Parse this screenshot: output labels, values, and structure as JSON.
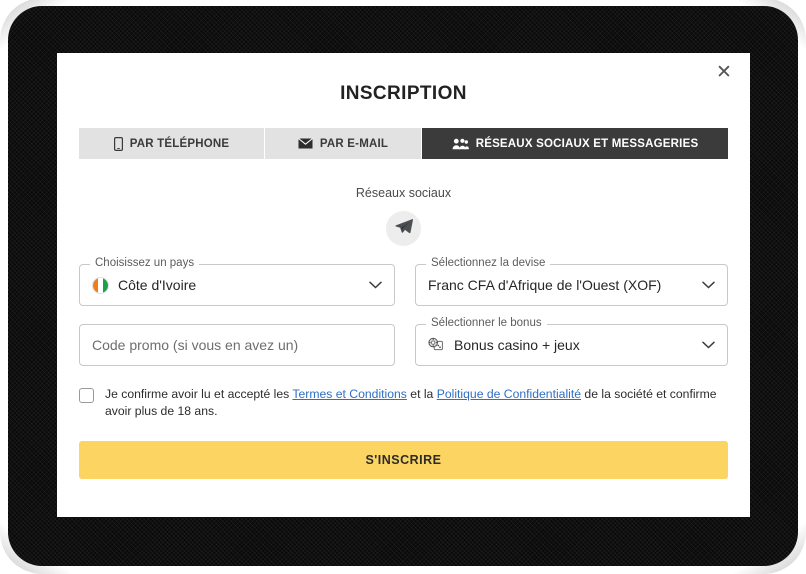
{
  "modal": {
    "title": "INSCRIPTION",
    "close_icon": "close-icon",
    "close_label": "✕"
  },
  "tabs": [
    {
      "label": "PAR TÉLÉPHONE",
      "icon": "phone-icon",
      "active": false
    },
    {
      "label": "PAR E-MAIL",
      "icon": "envelope-icon",
      "active": false
    },
    {
      "label": "RÉSEAUX SOCIAUX ET MESSAGERIES",
      "icon": "users-group-icon",
      "active": true
    }
  ],
  "social": {
    "heading": "Réseaux sociaux",
    "providers": [
      {
        "name": "telegram",
        "icon": "telegram-paper-plane-icon"
      }
    ]
  },
  "fields": {
    "country": {
      "label": "Choisissez un pays",
      "value": "Côte d'Ivoire",
      "icon": "cote-divoire-flag-icon",
      "flag_colors": [
        "#f07d1a",
        "#ffffff",
        "#1a9f4b"
      ],
      "chevron": "chevron-down-icon"
    },
    "currency": {
      "label": "Sélectionnez la devise",
      "value": "Franc CFA d'Afrique de l'Ouest (XOF)",
      "chevron": "chevron-down-icon"
    },
    "promo": {
      "placeholder": "Code promo (si vous en avez un)",
      "value": ""
    },
    "bonus": {
      "label": "Sélectionner le bonus",
      "value": "Bonus casino + jeux",
      "icon": "casino-chip-icon",
      "chevron": "chevron-down-icon"
    }
  },
  "consent": {
    "checked": false,
    "text_before": "Je confirme avoir lu et accepté les ",
    "link_terms": "Termes et Conditions",
    "text_middle": " et la ",
    "link_privacy": "Politique de Confidentialité",
    "text_after": " de la société et confirme avoir plus de 18 ans."
  },
  "submit": {
    "label": "S'INSCRIRE",
    "color": "#fcd462"
  },
  "colors": {
    "accent": "#fcd462",
    "active_tab_bg": "#3b3b3b",
    "inactive_tab_bg": "#e2e2e2",
    "link": "#2f6fc4",
    "backdrop": "#0a0a0a"
  }
}
